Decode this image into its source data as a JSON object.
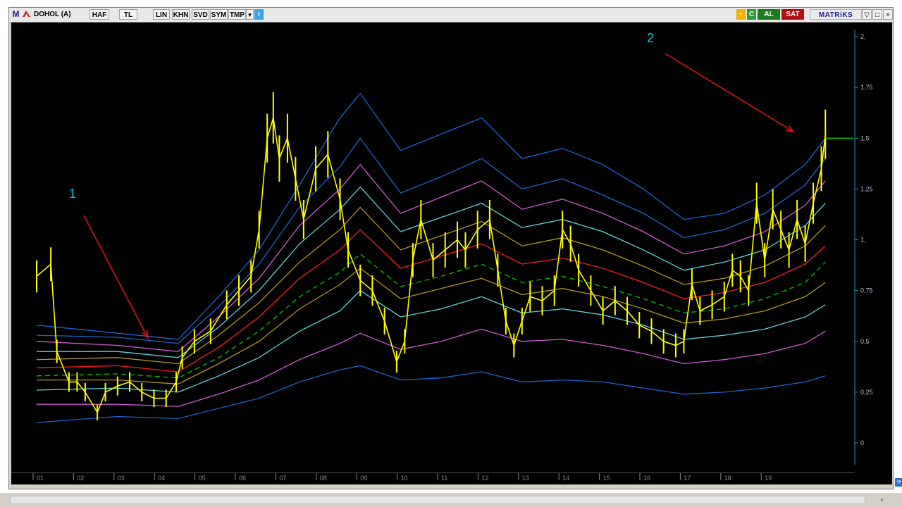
{
  "toolbar": {
    "menu_letter": "M",
    "symbol": "DOHOL (A)",
    "buttons": [
      "HAF",
      "TL",
      "LIN",
      "KHN",
      "SVD",
      "SYM",
      "TMP"
    ],
    "buy_label": "AL",
    "sell_label": "SAT",
    "brand": "MATRiKS"
  },
  "annotations": {
    "label_1": "1",
    "label_2": "2"
  },
  "colors": {
    "background": "#000000",
    "price": "#ffff00",
    "arrow": "#e01010",
    "label": "#00c8e0",
    "axis": "#1e9ab8",
    "last_price_line": "#00bb00",
    "bands": [
      "#1e64d2",
      "#d25ad2",
      "#64d2dc",
      "#b4961e",
      "#00c800",
      "#ff1e1e",
      "#b4961e",
      "#64d2dc",
      "#d25ad2",
      "#1e64d2"
    ]
  },
  "chart_data": {
    "type": "line",
    "x_ticks": [
      "01",
      "02",
      "03",
      "04",
      "05",
      "06",
      "07",
      "08",
      "09",
      "10",
      "11",
      "12",
      "13",
      "14",
      "15",
      "16",
      "17",
      "18",
      "19"
    ],
    "y_ticks": [
      "0",
      "0,25",
      "0,5",
      "0,75",
      "1,",
      "1,25",
      "1,5",
      "1,75",
      "2,"
    ],
    "ylim": [
      -0.05,
      2.03
    ],
    "series": [
      {
        "role": "price",
        "style": "bar-range",
        "points": [
          [
            0.0,
            0.82
          ],
          [
            0.35,
            0.88
          ],
          [
            0.5,
            0.45
          ],
          [
            0.8,
            0.3
          ],
          [
            1.0,
            0.3
          ],
          [
            1.2,
            0.25
          ],
          [
            1.5,
            0.15
          ],
          [
            1.7,
            0.25
          ],
          [
            2.0,
            0.28
          ],
          [
            2.3,
            0.3
          ],
          [
            2.6,
            0.25
          ],
          [
            2.9,
            0.22
          ],
          [
            3.2,
            0.22
          ],
          [
            3.45,
            0.3
          ],
          [
            3.6,
            0.42
          ],
          [
            3.9,
            0.5
          ],
          [
            4.3,
            0.55
          ],
          [
            4.7,
            0.68
          ],
          [
            5.0,
            0.75
          ],
          [
            5.3,
            0.82
          ],
          [
            5.5,
            1.05
          ],
          [
            5.7,
            1.5
          ],
          [
            5.85,
            1.6
          ],
          [
            6.0,
            1.4
          ],
          [
            6.2,
            1.5
          ],
          [
            6.4,
            1.3
          ],
          [
            6.6,
            1.1
          ],
          [
            6.9,
            1.35
          ],
          [
            7.2,
            1.42
          ],
          [
            7.5,
            1.2
          ],
          [
            7.7,
            0.95
          ],
          [
            8.0,
            0.8
          ],
          [
            8.3,
            0.75
          ],
          [
            8.6,
            0.6
          ],
          [
            8.9,
            0.4
          ],
          [
            9.1,
            0.5
          ],
          [
            9.3,
            0.9
          ],
          [
            9.5,
            1.1
          ],
          [
            9.8,
            0.9
          ],
          [
            10.1,
            0.95
          ],
          [
            10.4,
            1.0
          ],
          [
            10.6,
            0.95
          ],
          [
            10.9,
            1.05
          ],
          [
            11.2,
            1.1
          ],
          [
            11.4,
            0.85
          ],
          [
            11.6,
            0.6
          ],
          [
            11.8,
            0.48
          ],
          [
            12.0,
            0.6
          ],
          [
            12.2,
            0.72
          ],
          [
            12.5,
            0.7
          ],
          [
            12.8,
            0.75
          ],
          [
            13.0,
            1.05
          ],
          [
            13.2,
            0.98
          ],
          [
            13.4,
            0.85
          ],
          [
            13.7,
            0.75
          ],
          [
            14.0,
            0.65
          ],
          [
            14.3,
            0.7
          ],
          [
            14.6,
            0.65
          ],
          [
            14.9,
            0.58
          ],
          [
            15.2,
            0.55
          ],
          [
            15.5,
            0.5
          ],
          [
            15.8,
            0.48
          ],
          [
            16.0,
            0.5
          ],
          [
            16.2,
            0.78
          ],
          [
            16.4,
            0.65
          ],
          [
            16.7,
            0.68
          ],
          [
            17.0,
            0.72
          ],
          [
            17.2,
            0.85
          ],
          [
            17.4,
            0.82
          ],
          [
            17.6,
            0.75
          ],
          [
            17.8,
            1.18
          ],
          [
            18.0,
            0.9
          ],
          [
            18.2,
            1.15
          ],
          [
            18.4,
            1.05
          ],
          [
            18.6,
            0.95
          ],
          [
            18.8,
            1.1
          ],
          [
            19.0,
            0.98
          ],
          [
            19.2,
            1.18
          ],
          [
            19.4,
            1.35
          ],
          [
            19.5,
            1.52
          ]
        ]
      },
      {
        "role": "band",
        "points": [
          [
            0.0,
            0.1
          ],
          [
            2.0,
            0.13
          ],
          [
            3.5,
            0.12
          ],
          [
            4.5,
            0.17
          ],
          [
            5.5,
            0.22
          ],
          [
            6.5,
            0.3
          ],
          [
            7.5,
            0.36
          ],
          [
            8.0,
            0.38
          ],
          [
            9.0,
            0.31
          ],
          [
            10.0,
            0.32
          ],
          [
            11.0,
            0.35
          ],
          [
            12.0,
            0.3
          ],
          [
            13.0,
            0.31
          ],
          [
            14.0,
            0.3
          ],
          [
            15.0,
            0.27
          ],
          [
            16.0,
            0.24
          ],
          [
            17.0,
            0.25
          ],
          [
            18.0,
            0.27
          ],
          [
            19.0,
            0.3
          ],
          [
            19.5,
            0.33
          ]
        ]
      },
      {
        "role": "band",
        "points": [
          [
            0.0,
            0.19
          ],
          [
            2.0,
            0.19
          ],
          [
            3.5,
            0.18
          ],
          [
            4.5,
            0.24
          ],
          [
            5.5,
            0.31
          ],
          [
            6.5,
            0.41
          ],
          [
            7.5,
            0.49
          ],
          [
            8.0,
            0.54
          ],
          [
            9.0,
            0.46
          ],
          [
            10.0,
            0.5
          ],
          [
            11.0,
            0.56
          ],
          [
            12.0,
            0.5
          ],
          [
            13.0,
            0.51
          ],
          [
            14.0,
            0.48
          ],
          [
            15.0,
            0.44
          ],
          [
            16.0,
            0.39
          ],
          [
            17.0,
            0.41
          ],
          [
            18.0,
            0.44
          ],
          [
            19.0,
            0.49
          ],
          [
            19.5,
            0.55
          ]
        ]
      },
      {
        "role": "band",
        "points": [
          [
            0.0,
            0.26
          ],
          [
            2.0,
            0.27
          ],
          [
            3.5,
            0.25
          ],
          [
            4.5,
            0.33
          ],
          [
            5.5,
            0.42
          ],
          [
            6.5,
            0.55
          ],
          [
            7.5,
            0.65
          ],
          [
            8.0,
            0.75
          ],
          [
            9.0,
            0.62
          ],
          [
            10.0,
            0.66
          ],
          [
            11.0,
            0.72
          ],
          [
            12.0,
            0.64
          ],
          [
            13.0,
            0.66
          ],
          [
            14.0,
            0.63
          ],
          [
            15.0,
            0.58
          ],
          [
            16.0,
            0.51
          ],
          [
            17.0,
            0.53
          ],
          [
            18.0,
            0.56
          ],
          [
            19.0,
            0.62
          ],
          [
            19.5,
            0.68
          ]
        ]
      },
      {
        "role": "band",
        "points": [
          [
            0.0,
            0.31
          ],
          [
            2.0,
            0.31
          ],
          [
            3.5,
            0.29
          ],
          [
            4.5,
            0.39
          ],
          [
            5.5,
            0.5
          ],
          [
            6.5,
            0.66
          ],
          [
            7.5,
            0.78
          ],
          [
            8.0,
            0.86
          ],
          [
            9.0,
            0.71
          ],
          [
            10.0,
            0.76
          ],
          [
            11.0,
            0.81
          ],
          [
            12.0,
            0.73
          ],
          [
            13.0,
            0.76
          ],
          [
            14.0,
            0.72
          ],
          [
            15.0,
            0.66
          ],
          [
            16.0,
            0.59
          ],
          [
            17.0,
            0.61
          ],
          [
            18.0,
            0.65
          ],
          [
            19.0,
            0.72
          ],
          [
            19.5,
            0.79
          ]
        ]
      },
      {
        "role": "band",
        "points": [
          [
            0.0,
            0.33
          ],
          [
            2.0,
            0.34
          ],
          [
            3.5,
            0.32
          ],
          [
            4.5,
            0.42
          ],
          [
            5.5,
            0.55
          ],
          [
            6.5,
            0.72
          ],
          [
            7.5,
            0.84
          ],
          [
            8.0,
            0.93
          ],
          [
            9.0,
            0.77
          ],
          [
            10.0,
            0.82
          ],
          [
            11.0,
            0.88
          ],
          [
            12.0,
            0.79
          ],
          [
            13.0,
            0.82
          ],
          [
            14.0,
            0.77
          ],
          [
            15.0,
            0.71
          ],
          [
            16.0,
            0.64
          ],
          [
            17.0,
            0.66
          ],
          [
            18.0,
            0.71
          ],
          [
            19.0,
            0.79
          ],
          [
            19.5,
            0.89
          ]
        ]
      },
      {
        "role": "band",
        "points": [
          [
            0.0,
            0.37
          ],
          [
            2.0,
            0.38
          ],
          [
            3.5,
            0.35
          ],
          [
            4.5,
            0.47
          ],
          [
            5.5,
            0.62
          ],
          [
            6.5,
            0.81
          ],
          [
            7.5,
            0.95
          ],
          [
            8.0,
            1.05
          ],
          [
            9.0,
            0.86
          ],
          [
            10.0,
            0.92
          ],
          [
            11.0,
            0.98
          ],
          [
            12.0,
            0.88
          ],
          [
            13.0,
            0.91
          ],
          [
            14.0,
            0.86
          ],
          [
            15.0,
            0.79
          ],
          [
            16.0,
            0.71
          ],
          [
            17.0,
            0.74
          ],
          [
            18.0,
            0.79
          ],
          [
            19.0,
            0.88
          ],
          [
            19.5,
            0.97
          ]
        ]
      },
      {
        "role": "band",
        "points": [
          [
            0.0,
            0.41
          ],
          [
            2.0,
            0.42
          ],
          [
            3.5,
            0.39
          ],
          [
            4.5,
            0.53
          ],
          [
            5.5,
            0.69
          ],
          [
            6.5,
            0.89
          ],
          [
            7.5,
            1.05
          ],
          [
            8.0,
            1.16
          ],
          [
            9.0,
            0.95
          ],
          [
            10.0,
            1.02
          ],
          [
            11.0,
            1.09
          ],
          [
            12.0,
            0.97
          ],
          [
            13.0,
            1.01
          ],
          [
            14.0,
            0.95
          ],
          [
            15.0,
            0.87
          ],
          [
            16.0,
            0.78
          ],
          [
            17.0,
            0.81
          ],
          [
            18.0,
            0.87
          ],
          [
            19.0,
            0.97
          ],
          [
            19.5,
            1.07
          ]
        ]
      },
      {
        "role": "band",
        "points": [
          [
            0.0,
            0.45
          ],
          [
            2.0,
            0.45
          ],
          [
            3.5,
            0.42
          ],
          [
            4.5,
            0.57
          ],
          [
            5.5,
            0.75
          ],
          [
            6.5,
            0.98
          ],
          [
            7.5,
            1.15
          ],
          [
            8.0,
            1.26
          ],
          [
            9.0,
            1.04
          ],
          [
            10.0,
            1.11
          ],
          [
            11.0,
            1.18
          ],
          [
            12.0,
            1.06
          ],
          [
            13.0,
            1.1
          ],
          [
            14.0,
            1.04
          ],
          [
            15.0,
            0.95
          ],
          [
            16.0,
            0.85
          ],
          [
            17.0,
            0.89
          ],
          [
            18.0,
            0.95
          ],
          [
            19.0,
            1.07
          ],
          [
            19.5,
            1.18
          ]
        ]
      },
      {
        "role": "band",
        "points": [
          [
            0.0,
            0.5
          ],
          [
            2.0,
            0.48
          ],
          [
            3.5,
            0.45
          ],
          [
            4.5,
            0.62
          ],
          [
            5.5,
            0.81
          ],
          [
            6.5,
            1.07
          ],
          [
            7.5,
            1.25
          ],
          [
            8.0,
            1.37
          ],
          [
            9.0,
            1.13
          ],
          [
            10.0,
            1.21
          ],
          [
            11.0,
            1.29
          ],
          [
            12.0,
            1.15
          ],
          [
            13.0,
            1.2
          ],
          [
            14.0,
            1.13
          ],
          [
            15.0,
            1.04
          ],
          [
            16.0,
            0.93
          ],
          [
            17.0,
            0.97
          ],
          [
            18.0,
            1.04
          ],
          [
            19.0,
            1.17
          ],
          [
            19.5,
            1.29
          ]
        ]
      },
      {
        "role": "band",
        "points": [
          [
            0.0,
            0.53
          ],
          [
            2.0,
            0.52
          ],
          [
            3.5,
            0.49
          ],
          [
            4.5,
            0.67
          ],
          [
            5.5,
            0.88
          ],
          [
            6.5,
            1.16
          ],
          [
            7.5,
            1.36
          ],
          [
            8.0,
            1.5
          ],
          [
            9.0,
            1.23
          ],
          [
            10.0,
            1.31
          ],
          [
            11.0,
            1.4
          ],
          [
            12.0,
            1.25
          ],
          [
            13.0,
            1.3
          ],
          [
            14.0,
            1.22
          ],
          [
            15.0,
            1.13
          ],
          [
            16.0,
            1.01
          ],
          [
            17.0,
            1.05
          ],
          [
            18.0,
            1.13
          ],
          [
            19.0,
            1.27
          ],
          [
            19.5,
            1.4
          ]
        ]
      },
      {
        "role": "band",
        "points": [
          [
            0.0,
            0.58
          ],
          [
            2.0,
            0.54
          ],
          [
            3.5,
            0.51
          ],
          [
            4.5,
            0.72
          ],
          [
            5.5,
            0.95
          ],
          [
            6.5,
            1.27
          ],
          [
            7.5,
            1.6
          ],
          [
            8.0,
            1.72
          ],
          [
            9.0,
            1.44
          ],
          [
            10.0,
            1.52
          ],
          [
            11.0,
            1.6
          ],
          [
            12.0,
            1.4
          ],
          [
            13.0,
            1.45
          ],
          [
            14.0,
            1.37
          ],
          [
            15.0,
            1.25
          ],
          [
            16.0,
            1.1
          ],
          [
            17.0,
            1.13
          ],
          [
            18.0,
            1.22
          ],
          [
            19.0,
            1.37
          ],
          [
            19.5,
            1.5
          ]
        ]
      }
    ],
    "last_value": 1.5,
    "grid": false
  }
}
